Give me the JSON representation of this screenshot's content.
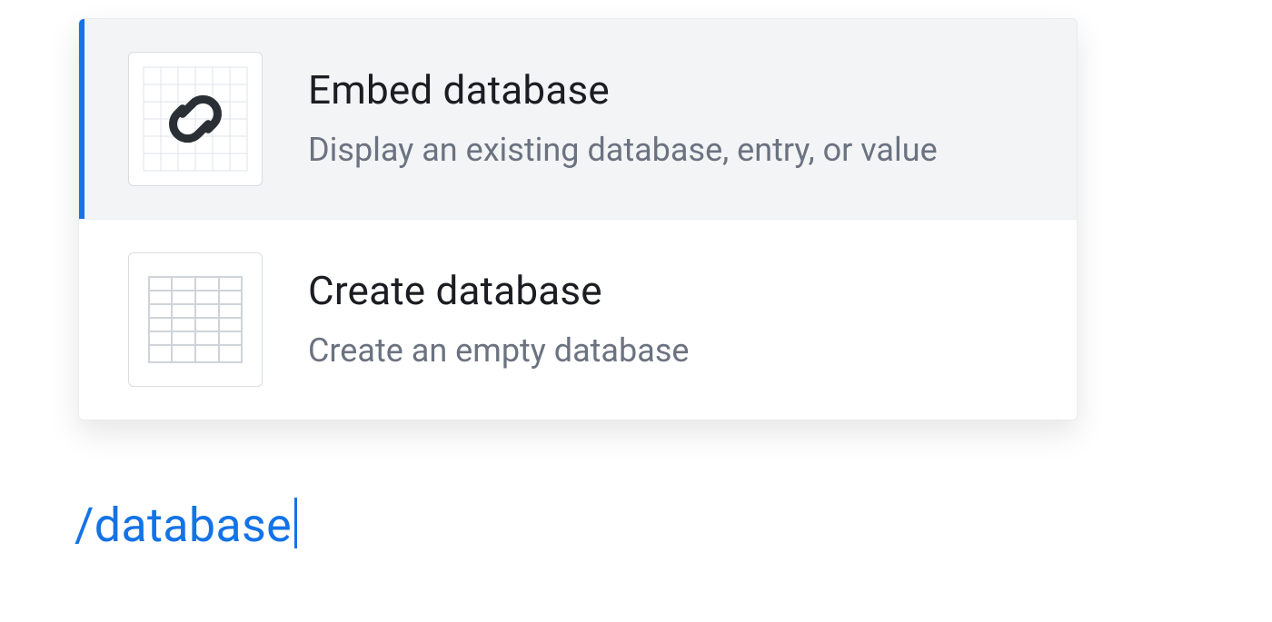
{
  "command_input": {
    "value": "/database"
  },
  "menu": {
    "items": [
      {
        "title": "Embed database",
        "description": "Display an existing database, entry, or value",
        "icon": "link-grid-icon",
        "selected": true
      },
      {
        "title": "Create database",
        "description": "Create an empty database",
        "icon": "table-grid-icon",
        "selected": false
      }
    ]
  },
  "colors": {
    "accent": "#1473e6",
    "text_primary": "#1b1d22",
    "text_secondary": "#6b7280",
    "hover_bg": "#f3f4f6",
    "border": "#e9ebee"
  }
}
